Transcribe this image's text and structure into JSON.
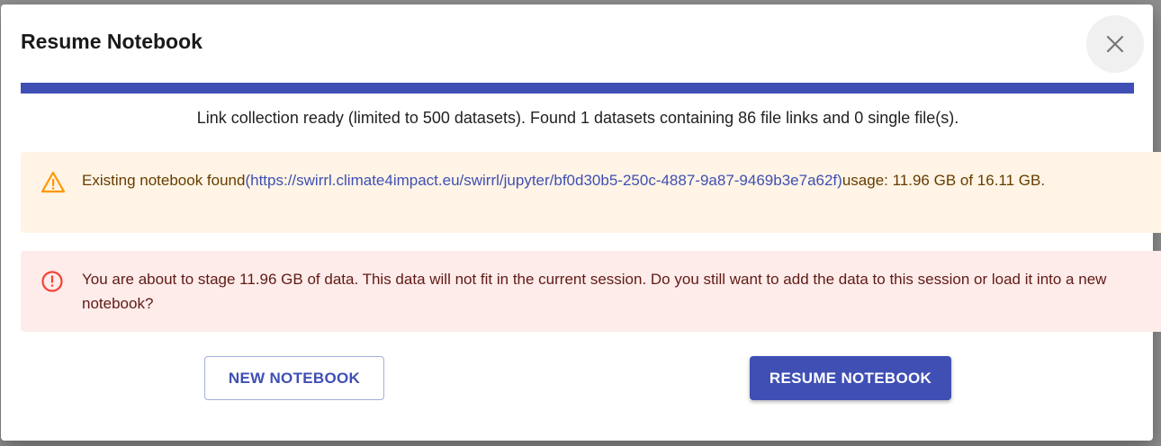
{
  "dialog": {
    "title": "Resume Notebook",
    "close_icon": "close-icon"
  },
  "progress": {
    "percent": 100,
    "color": "#3f4fb4"
  },
  "status_text": "Link collection ready (limited to 500 datasets). Found 1 datasets containing 86 file links and 0 single file(s).",
  "warning": {
    "icon": "warning-triangle-icon",
    "prefix": "Existing notebook found",
    "link_text": "(https://swirrl.climate4impact.eu/swirrl/jupyter/bf0d30b5-250c-4887-9a87-9469b3e7a62f)",
    "suffix": "usage: 11.96 GB of 16.11 GB.",
    "background": "#fff4e5",
    "color": "#663c00",
    "icon_color": "#ff9800"
  },
  "error": {
    "icon": "error-circle-icon",
    "text": "You are about to stage 11.96 GB of data. This data will not fit in the current session. Do you still want to add the data to this session or load it into a new notebook?",
    "background": "#fdecea",
    "color": "#611a15",
    "icon_color": "#f44336"
  },
  "buttons": {
    "new_notebook": "NEW NOTEBOOK",
    "resume_notebook": "RESUME NOTEBOOK"
  }
}
